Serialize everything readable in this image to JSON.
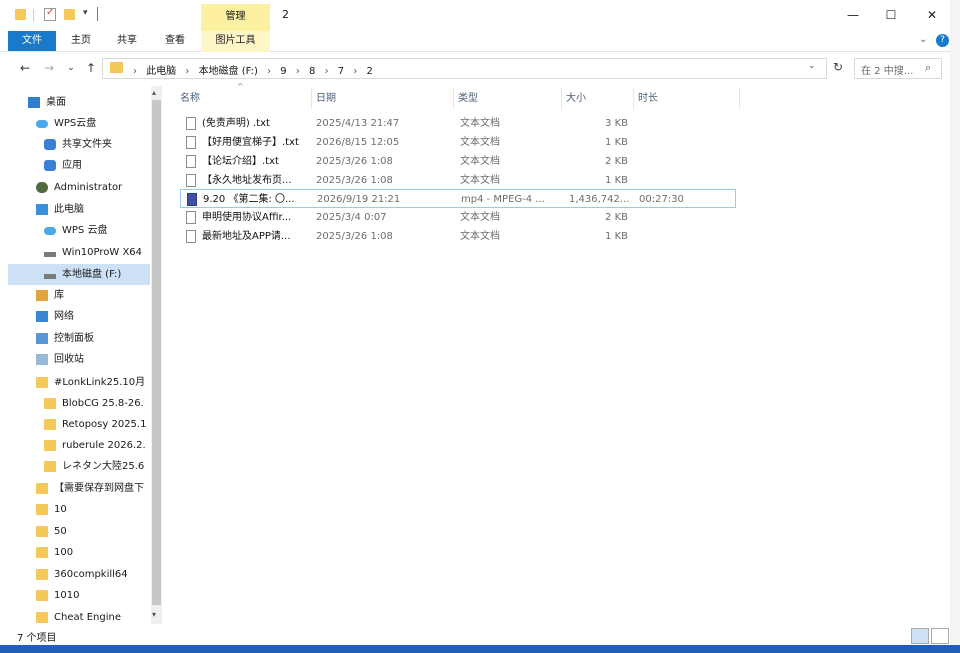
{
  "window": {
    "title": "2",
    "context_tab": "管理",
    "controls": {
      "minimize": "—",
      "maximize": "☐",
      "close": "✕"
    }
  },
  "ribbon": {
    "tabs": [
      {
        "label": "文件"
      },
      {
        "label": "主页"
      },
      {
        "label": "共享"
      },
      {
        "label": "查看"
      },
      {
        "label": "图片工具"
      }
    ]
  },
  "address": {
    "crumbs": [
      "此电脑",
      "本地磁盘 (F:)",
      "9",
      "8",
      "7",
      "2"
    ],
    "separator": "›",
    "search_placeholder": "在 2 中搜..."
  },
  "sidebar": {
    "items": [
      {
        "label": "桌面",
        "icon": "desktop-icon"
      },
      {
        "label": "WPS云盘",
        "icon": "cloud-icon"
      },
      {
        "label": "共享文件夹",
        "icon": "share-icon"
      },
      {
        "label": "应用",
        "icon": "apps-icon"
      },
      {
        "label": "Administrator",
        "icon": "user-icon"
      },
      {
        "label": "此电脑",
        "icon": "computer-icon"
      },
      {
        "label": "WPS 云盘",
        "icon": "cloud-icon"
      },
      {
        "label": "Win10ProW X64",
        "icon": "drive-icon"
      },
      {
        "label": "本地磁盘 (F:)",
        "icon": "drive-icon"
      },
      {
        "label": "库",
        "icon": "library-icon"
      },
      {
        "label": "网络",
        "icon": "network-icon"
      },
      {
        "label": "控制面板",
        "icon": "control-panel-icon"
      },
      {
        "label": "回收站",
        "icon": "recycle-bin-icon"
      },
      {
        "label": "#LonkLink25.10月",
        "icon": "folder-icon"
      },
      {
        "label": "BlobCG 25.8-26.",
        "icon": "folder-icon"
      },
      {
        "label": "Retoposy 2025.1",
        "icon": "folder-icon"
      },
      {
        "label": "ruberule 2026.2.",
        "icon": "folder-icon"
      },
      {
        "label": "レネタン大陸25.6",
        "icon": "folder-icon"
      },
      {
        "label": "【需要保存到网盘下",
        "icon": "folder-icon"
      },
      {
        "label": "10",
        "icon": "folder-icon"
      },
      {
        "label": "50",
        "icon": "folder-icon"
      },
      {
        "label": "100",
        "icon": "folder-icon"
      },
      {
        "label": "360compkill64",
        "icon": "folder-icon"
      },
      {
        "label": "1010",
        "icon": "folder-icon"
      },
      {
        "label": "Cheat Engine",
        "icon": "folder-icon"
      }
    ]
  },
  "columns": {
    "name": "名称",
    "date": "日期",
    "type": "类型",
    "size": "大小",
    "duration": "时长"
  },
  "files": [
    {
      "name": "(免责声明) .txt",
      "date": "2025/4/13 21:47",
      "type": "文本文档",
      "size": "3 KB",
      "duration": ""
    },
    {
      "name": "【好用便宜梯子】.txt",
      "date": "2026/8/15 12:05",
      "type": "文本文档",
      "size": "1 KB",
      "duration": ""
    },
    {
      "name": "【论坛介绍】.txt",
      "date": "2025/3/26 1:08",
      "type": "文本文档",
      "size": "2 KB",
      "duration": ""
    },
    {
      "name": "【永久地址发布页...",
      "date": "2025/3/26 1:08",
      "type": "文本文档",
      "size": "1 KB",
      "duration": ""
    },
    {
      "name": "9.20 《第二集: 〇...",
      "date": "2026/9/19 21:21",
      "type": "mp4 - MPEG-4 ...",
      "size": "1,436,742...",
      "duration": "00:27:30"
    },
    {
      "name": "申明使用协议Affir...",
      "date": "2025/3/4 0:07",
      "type": "文本文档",
      "size": "2 KB",
      "duration": ""
    },
    {
      "name": "最新地址及APP请...",
      "date": "2025/3/26 1:08",
      "type": "文本文档",
      "size": "1 KB",
      "duration": ""
    }
  ],
  "status": {
    "count_text": "7 个项目"
  }
}
